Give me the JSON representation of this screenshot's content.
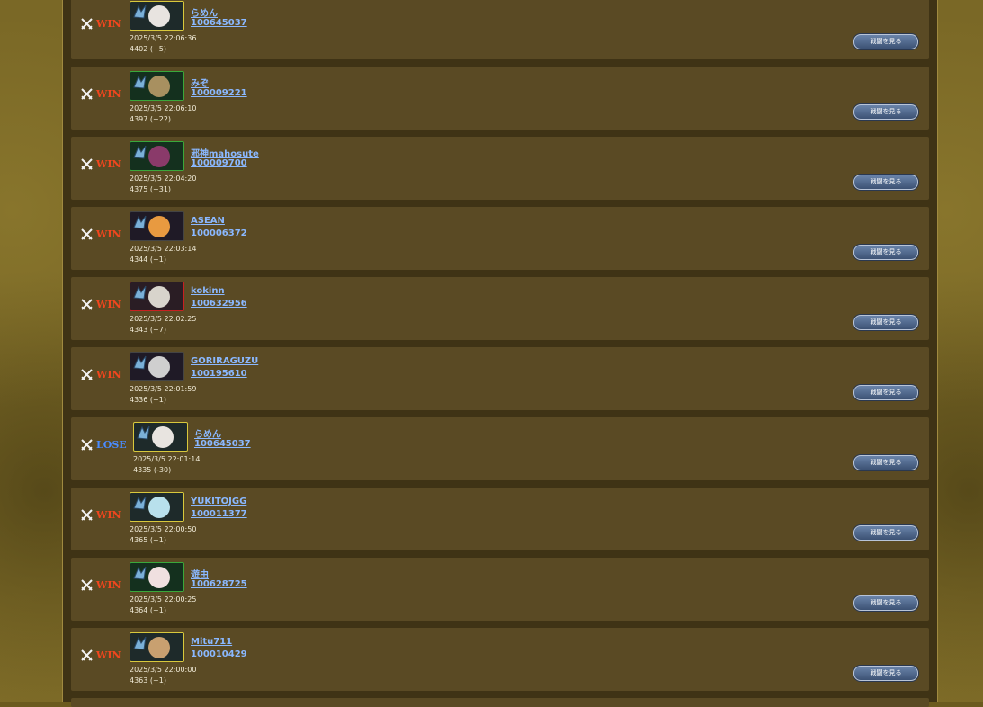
{
  "colors": {
    "win": "#f0461e",
    "lose": "#4a8cff",
    "link": "#8ab8ff"
  },
  "battles": [
    {
      "result": "WIN",
      "name": "らめん",
      "id": "100645037",
      "datetime": "2025/3/5 22:06:36",
      "rating": "4402 (+5)",
      "portrait": "#e8e4e0",
      "frame": "yellow"
    },
    {
      "result": "WIN",
      "name": "みぞ",
      "id": "100009221",
      "datetime": "2025/3/5 22:06:10",
      "rating": "4397 (+22)",
      "portrait": "#a89060",
      "frame": "green"
    },
    {
      "result": "WIN",
      "name": "邪神mahosute",
      "id": "100009700",
      "datetime": "2025/3/5 22:04:20",
      "rating": "4375 (+31)",
      "portrait": "#8a3a6a",
      "frame": "green"
    },
    {
      "result": "WIN",
      "name": "ASEAN",
      "id": "100006372",
      "datetime": "2025/3/5 22:03:14",
      "rating": "4344 (+1)",
      "portrait": "#e89a40",
      "frame": "dark"
    },
    {
      "result": "WIN",
      "name": "kokinn",
      "id": "100632956",
      "datetime": "2025/3/5 22:02:25",
      "rating": "4343 (+7)",
      "portrait": "#d8d4cc",
      "frame": "red"
    },
    {
      "result": "WIN",
      "name": "GORIRAGUZU",
      "id": "100195610",
      "datetime": "2025/3/5 22:01:59",
      "rating": "4336 (+1)",
      "portrait": "#cfcfcf",
      "frame": "dark"
    },
    {
      "result": "LOSE",
      "name": "らめん",
      "id": "100645037",
      "datetime": "2025/3/5 22:01:14",
      "rating": "4335 (-30)",
      "portrait": "#e8e4e0",
      "frame": "yellow"
    },
    {
      "result": "WIN",
      "name": "YUKITOJGG",
      "id": "100011377",
      "datetime": "2025/3/5 22:00:50",
      "rating": "4365 (+1)",
      "portrait": "#b8e0ec",
      "frame": "yellow"
    },
    {
      "result": "WIN",
      "name": "遊由",
      "id": "100628725",
      "datetime": "2025/3/5 22:00:25",
      "rating": "4364 (+1)",
      "portrait": "#f0e0e0",
      "frame": "green"
    },
    {
      "result": "WIN",
      "name": "Mitu711",
      "id": "100010429",
      "datetime": "2025/3/5 22:00:00",
      "rating": "4363 (+1)",
      "portrait": "#c8a070",
      "frame": "yellow"
    }
  ],
  "watch_label": "戦闘を見る"
}
